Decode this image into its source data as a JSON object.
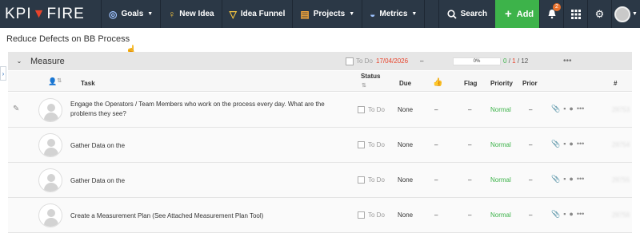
{
  "nav": {
    "logo_left": "KPI",
    "logo_right": "FIRE",
    "goals": "Goals",
    "new_idea": "New Idea",
    "idea_funnel": "Idea Funnel",
    "projects": "Projects",
    "metrics": "Metrics",
    "search": "Search",
    "add": "Add",
    "notifications_count": "2"
  },
  "page_title": "Reduce Defects on BB Process",
  "group": {
    "name": "Measure",
    "status": "To Do",
    "date": "17/04/2026",
    "dash": "–",
    "progress": "0%",
    "count_done": "0",
    "count_overdue": "1",
    "count_total": "12",
    "sep": "/"
  },
  "columns": {
    "task": "Task",
    "status": "Status",
    "due": "Due",
    "flag": "Flag",
    "priority": "Priority",
    "prior": "Prior",
    "number": "#"
  },
  "rows": [
    {
      "task": "Engage the Operators / Team Members who work on the process every day. What are the problems they see?",
      "status": "To Do",
      "due": "None",
      "vote": "–",
      "flag": "–",
      "priority": "Normal",
      "prior": "–",
      "number": "28753"
    },
    {
      "task": "Gather Data on the",
      "status": "To Do",
      "due": "None",
      "vote": "–",
      "flag": "–",
      "priority": "Normal",
      "prior": "–",
      "number": "28754"
    },
    {
      "task": "Gather Data on the",
      "status": "To Do",
      "due": "None",
      "vote": "–",
      "flag": "–",
      "priority": "Normal",
      "prior": "–",
      "number": "28755"
    },
    {
      "task": "Create a Measurement Plan (See Attached Measurement Plan Tool)",
      "status": "To Do",
      "due": "None",
      "vote": "–",
      "flag": "–",
      "priority": "Normal",
      "prior": "–",
      "number": "28756"
    }
  ]
}
